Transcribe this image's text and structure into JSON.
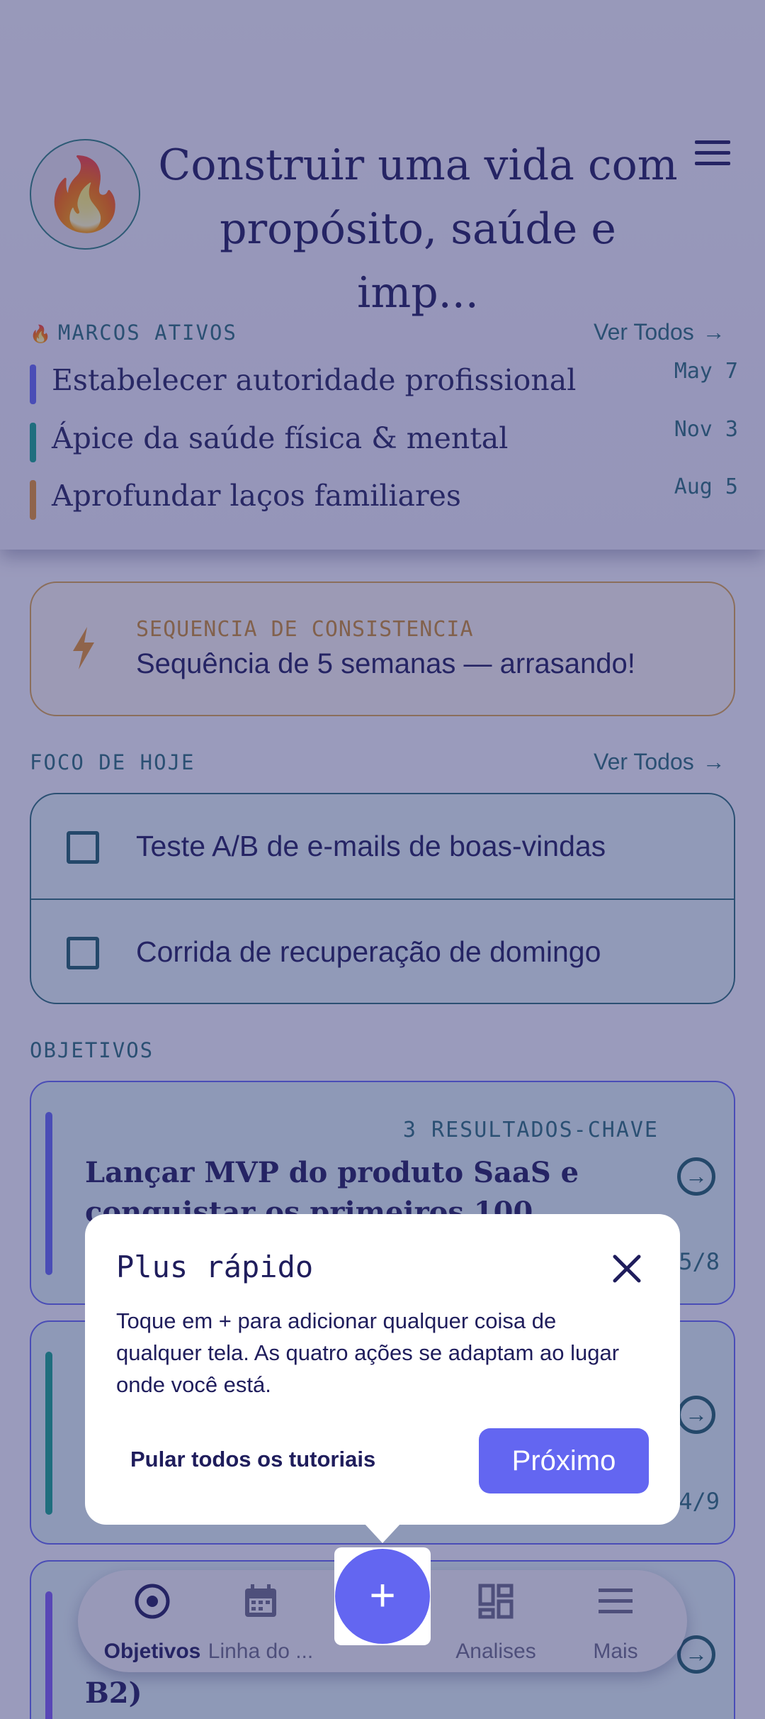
{
  "header": {
    "avatar_emoji": "🔥",
    "title": "Construir uma vida com propósito, saúde e imp..."
  },
  "milestones": {
    "heading": "MARCOS ATIVOS",
    "see_all": "Ver Todos",
    "items": [
      {
        "label": "Estabelecer autoridade profissional",
        "date": "May 7",
        "color": "#6366f1"
      },
      {
        "label": "Ápice da saúde física & mental",
        "date": "Nov 3",
        "color": "#14a38b"
      },
      {
        "label": "Aprofundar laços familiares",
        "date": "Aug 5",
        "color": "#e0902f"
      }
    ]
  },
  "streak": {
    "kicker": "SEQUENCIA DE CONSISTENCIA",
    "message": "Sequência de 5 semanas — arrasando!"
  },
  "focus": {
    "heading": "FOCO DE HOJE",
    "see_all": "Ver Todos",
    "tasks": [
      {
        "label": "Teste A/B de e-mails de boas-vindas",
        "checked": false
      },
      {
        "label": "Corrida de recuperação de domingo",
        "checked": false
      }
    ]
  },
  "objectives": {
    "heading": "OBJETIVOS",
    "items": [
      {
        "kicker": "3 RESULTADOS-CHAVE",
        "title": "Lançar MVP do produto SaaS e conquistar os primeiros 100 usuários",
        "count": "5/8",
        "color": "#6366f1"
      },
      {
        "kicker": "",
        "title": "",
        "count": "4/9",
        "color": "#14a38b"
      },
      {
        "kicker": "",
        "title": "B2)",
        "count": "",
        "color": "#7c5cf0"
      }
    ]
  },
  "nav": {
    "items": [
      {
        "label": "Objetivos",
        "icon": "target-icon",
        "active": true
      },
      {
        "label": "Linha do ...",
        "icon": "calendar-icon",
        "active": false
      },
      {
        "label": "Analises",
        "icon": "dashboard-icon",
        "active": false
      },
      {
        "label": "Mais",
        "icon": "menu-icon",
        "active": false
      }
    ],
    "fab_label": "+"
  },
  "tutorial": {
    "title": "Plus rápido",
    "body": "Toque em + para adicionar qualquer coisa de qualquer tela. As quatro ações se adaptam ao lugar onde você está.",
    "skip_label": "Pular todos os tutoriais",
    "next_label": "Próximo"
  },
  "colors": {
    "accent": "#6366f1",
    "teal": "#2a6c77",
    "streak": "#e0902f",
    "scrim": "#2c2e6e"
  }
}
